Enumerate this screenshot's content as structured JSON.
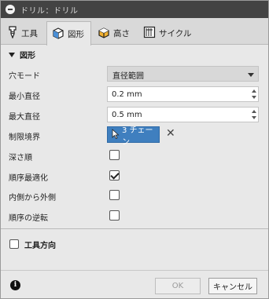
{
  "window": {
    "title": "ドリル：ドリル"
  },
  "tabs": [
    {
      "label": "工具",
      "icon": "tool-icon"
    },
    {
      "label": "図形",
      "icon": "geometry-cube-icon",
      "active": true
    },
    {
      "label": "高さ",
      "icon": "heights-icon"
    },
    {
      "label": "サイクル",
      "icon": "cycle-icon"
    }
  ],
  "geometry": {
    "section_title": "図形",
    "hole_mode": {
      "label": "穴モード",
      "value": "直径範囲"
    },
    "min_diameter": {
      "label": "最小直径",
      "value": "0.2 mm"
    },
    "max_diameter": {
      "label": "最大直径",
      "value": "0.5 mm"
    },
    "boundary": {
      "label": "制限境界",
      "selection": "3 チェーン"
    },
    "depth_order": {
      "label": "深さ順",
      "checked": false
    },
    "optimize_order": {
      "label": "順序最適化",
      "checked": true
    },
    "inside_out": {
      "label": "内側から外側",
      "checked": false
    },
    "reverse_order": {
      "label": "順序の逆転",
      "checked": false
    }
  },
  "tool_orientation": {
    "label": "工具方向",
    "checked": false
  },
  "footer": {
    "ok_label": "OK",
    "cancel_label": "キャンセル"
  },
  "colors": {
    "accent": "#3f7fbf",
    "titlebar": "#434343",
    "panel": "#e8e8e8"
  }
}
